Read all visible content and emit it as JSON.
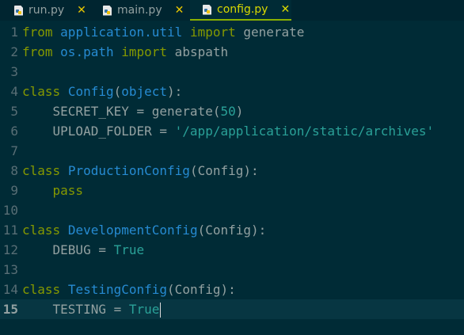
{
  "tabs": [
    {
      "label": "run.py",
      "close": "✕"
    },
    {
      "label": "main.py",
      "close": "✕"
    },
    {
      "label": "config.py",
      "close": "✕"
    }
  ],
  "lines": [
    {
      "n": "1",
      "p": [
        "from",
        " ",
        "application.util",
        " ",
        "import",
        " generate"
      ]
    },
    {
      "n": "2",
      "p": [
        "from",
        " ",
        "os.path",
        " ",
        "import",
        " abspath"
      ]
    },
    {
      "n": "3",
      "p": []
    },
    {
      "n": "4",
      "p": [
        "class",
        " ",
        "Config",
        "(",
        "object",
        "):"
      ]
    },
    {
      "n": "5",
      "p": [
        "    SECRET_KEY = generate(",
        "50",
        ")"
      ]
    },
    {
      "n": "6",
      "p": [
        "    UPLOAD_FOLDER = ",
        "'/app/application/static/archives'"
      ]
    },
    {
      "n": "7",
      "p": []
    },
    {
      "n": "8",
      "p": [
        "class",
        " ",
        "ProductionConfig",
        "(Config):"
      ]
    },
    {
      "n": "9",
      "p": [
        "    ",
        "pass"
      ]
    },
    {
      "n": "10",
      "p": []
    },
    {
      "n": "11",
      "p": [
        "class",
        " ",
        "DevelopmentConfig",
        "(Config):"
      ]
    },
    {
      "n": "12",
      "p": [
        "    DEBUG = ",
        "True"
      ]
    },
    {
      "n": "13",
      "p": []
    },
    {
      "n": "14",
      "p": [
        "class",
        " ",
        "TestingConfig",
        "(Config):"
      ]
    },
    {
      "n": "15",
      "p": [
        "    TESTING = ",
        "True"
      ]
    }
  ]
}
